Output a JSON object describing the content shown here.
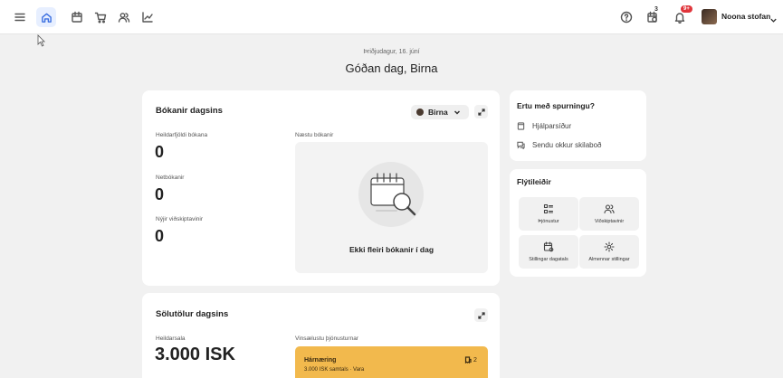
{
  "header": {
    "user_name": "Noona stofan",
    "calendar_badge": "3",
    "notification_badge": "9+"
  },
  "page": {
    "date": "Þriðjudagur, 16. júní",
    "greeting": "Góðan dag, Birna"
  },
  "bookings_card": {
    "title": "Bókanir dagsins",
    "staff_selector": "Birna",
    "total_label": "Heildarfjöldi bókana",
    "total_value": "0",
    "online_label": "Netbókanir",
    "online_value": "0",
    "new_customers_label": "Nýjir viðskiptavinir",
    "new_customers_value": "0",
    "next_label": "Næstu bókanir",
    "empty_text": "Ekki fleiri bókanir í dag"
  },
  "help_card": {
    "title": "Ertu með spurningu?",
    "items": [
      "Hjálparsíður",
      "Sendu okkur skilaboð"
    ]
  },
  "shortcuts_card": {
    "title": "Flýtileiðir",
    "tiles": [
      {
        "label": "Þjónustur",
        "icon": "list-icon"
      },
      {
        "label": "Viðskiptavinir",
        "icon": "users-icon"
      },
      {
        "label": "Stillingar dagatals",
        "icon": "calendar-settings-icon"
      },
      {
        "label": "Almennar stillingar",
        "icon": "gear-icon"
      }
    ]
  },
  "sales_card": {
    "title": "Sölutölur dagsins",
    "total_label": "Heildarsala",
    "total_value": "3.000 ISK",
    "popular_label": "Vinsælustu þjónusturnar",
    "service_name": "Hárnæring",
    "service_detail": "3.000 ISK samtals · Vara",
    "service_count": "2"
  },
  "colors": {
    "accent": "#3b6fe0",
    "highlight": "#f2b94d",
    "badge": "#e0353b"
  }
}
